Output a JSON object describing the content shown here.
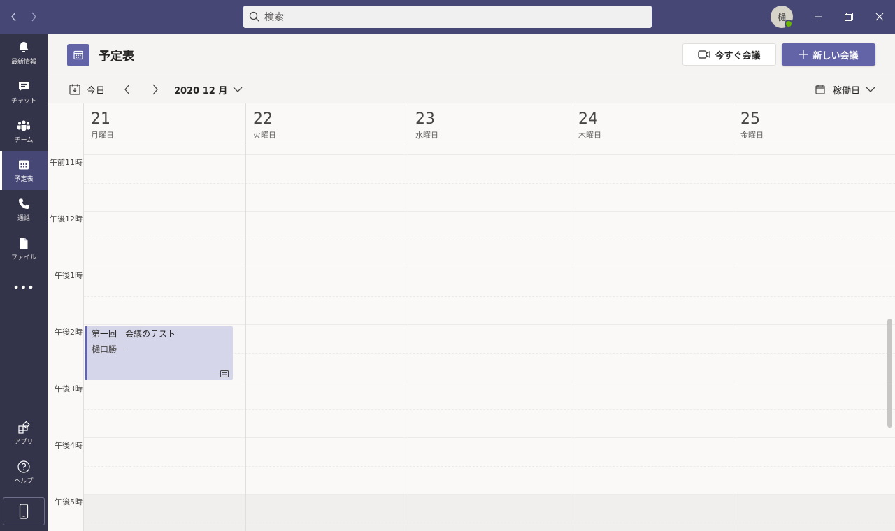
{
  "titlebar": {
    "back_icon": "chevron-left",
    "forward_icon": "chevron-right",
    "search_placeholder": "検索",
    "avatar_initial": "樋",
    "presence_color": "#6bb700"
  },
  "rail": {
    "items": [
      {
        "label": "最新情報",
        "icon": "bell-icon"
      },
      {
        "label": "チャット",
        "icon": "chat-icon"
      },
      {
        "label": "チーム",
        "icon": "teams-icon"
      },
      {
        "label": "予定表",
        "icon": "calendar-icon",
        "active": true
      },
      {
        "label": "通話",
        "icon": "phone-icon"
      },
      {
        "label": "ファイル",
        "icon": "file-icon"
      }
    ],
    "more": "•••",
    "bottom": [
      {
        "label": "アプリ",
        "icon": "apps-icon"
      },
      {
        "label": "ヘルプ",
        "icon": "help-icon"
      }
    ]
  },
  "header": {
    "title": "予定表",
    "meet_now_label": "今すぐ会議",
    "new_meeting_label": "新しい会議"
  },
  "toolbar": {
    "today_label": "今日",
    "month_label": "2020 12 月",
    "view_label": "稼働日"
  },
  "days": [
    {
      "num": "21",
      "name": "月曜日"
    },
    {
      "num": "22",
      "name": "火曜日"
    },
    {
      "num": "23",
      "name": "水曜日"
    },
    {
      "num": "24",
      "name": "木曜日"
    },
    {
      "num": "25",
      "name": "金曜日"
    }
  ],
  "times": [
    "午前11時",
    "午後12時",
    "午後1時",
    "午後2時",
    "午後3時",
    "午後4時",
    "午後5時"
  ],
  "event": {
    "title": "第一回　会議のテスト",
    "organizer": "樋口勝一"
  },
  "colors": {
    "brand": "#6264a7",
    "titlebar": "#464775",
    "rail": "#33344a",
    "event_bg": "#d6d6ea"
  }
}
